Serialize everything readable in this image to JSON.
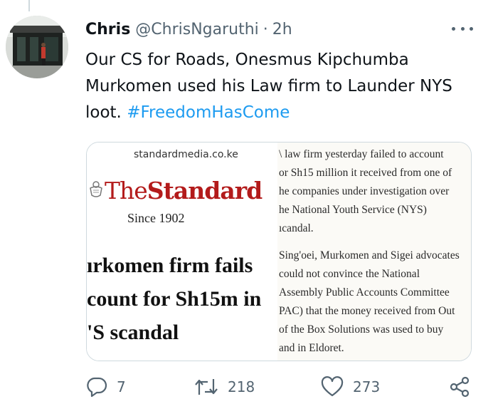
{
  "tweet": {
    "author_name": "Chris",
    "author_handle": "@ChrisNgaruthi",
    "separator": "·",
    "timestamp": "2h",
    "text": "Our CS for Roads, Onesmus Kipchumba Murkomen used his Law firm to Launder NYS loot. ",
    "hashtag": "#FreedomHasCome"
  },
  "card": {
    "source": "standardmedia.co.ke",
    "logo_light": "The",
    "logo_bold": "Standard",
    "since": "Since 1902",
    "headline_lines": [
      "ırkomen firm fails",
      "count for Sh15m in",
      "'S scandal"
    ],
    "article_lines": [
      "\\ law firm yesterday failed to account",
      "or Sh15 million it received from one of",
      "he companies under investigation over",
      "he National Youth Service (NYS)",
      "ıcandal.",
      "",
      "Sing'oei, Murkomen and Sigei advocates",
      "could not convince the National",
      "Assembly Public Accounts Committee",
      "PAC) that the money received from Out",
      "of the Box Solutions was used to buy",
      "and in Eldoret."
    ]
  },
  "actions": {
    "replies": "7",
    "retweets": "218",
    "likes": "273"
  },
  "icons": {
    "reply": "reply-icon",
    "retweet": "retweet-icon",
    "like": "heart-icon",
    "share": "share-icon",
    "more": "more-options-icon"
  },
  "colors": {
    "accent": "#1d9bf0",
    "muted": "#536471",
    "logo_red": "#b31b1b"
  }
}
